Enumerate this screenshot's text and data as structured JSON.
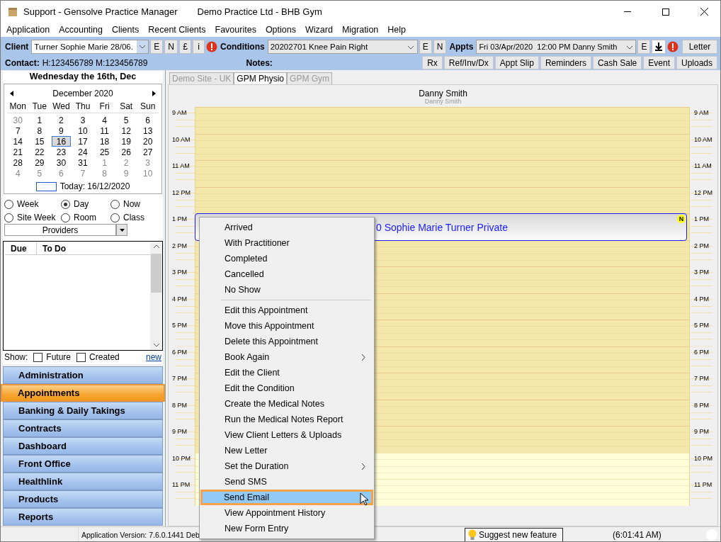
{
  "window": {
    "title": "Support - Gensolve Practice Manager",
    "subtitle": "Demo Practice Ltd - BHB Gym"
  },
  "menu_bar": [
    "Application",
    "Accounting",
    "Clients",
    "Recent Clients",
    "Favourites",
    "Options",
    "Wizard",
    "Migration",
    "Help"
  ],
  "client_bar": {
    "client_label": "Client",
    "client_value": "Turner Sophie Marie 28/06.",
    "client_buttons": [
      "E",
      "N",
      "£",
      "i"
    ],
    "conditions_label": "Conditions",
    "conditions_value": "20202701 Knee Pain Right",
    "condition_buttons": [
      "E",
      "N"
    ],
    "appts_label": "Appts",
    "appts_value": "Fri 03/Apr/2020  12:00 PM Danny Smith",
    "appt_buttons": [
      "E"
    ],
    "letter_button": "Letter",
    "contact_label": "Contact:",
    "contact_value": "H:123456789  M:123456789",
    "notes_label": "Notes:",
    "actions": [
      "Rx",
      "Ref/Inv/Dx",
      "Appt Slip",
      "Reminders",
      "Cash Sale",
      "Event",
      "Uploads"
    ]
  },
  "date_header": "Wednesday the 16th, Dec",
  "calendar": {
    "month": "December 2020",
    "weekdays": [
      "Mon",
      "Tue",
      "Wed",
      "Thu",
      "Fri",
      "Sat",
      "Sun"
    ],
    "weeks": [
      [
        {
          "day": "30",
          "muted": true,
          "selected": false
        },
        {
          "day": "1",
          "muted": false,
          "selected": false
        },
        {
          "day": "2",
          "muted": false,
          "selected": false
        },
        {
          "day": "3",
          "muted": false,
          "selected": false
        },
        {
          "day": "4",
          "muted": false,
          "selected": false
        },
        {
          "day": "5",
          "muted": false,
          "selected": false
        },
        {
          "day": "6",
          "muted": false,
          "selected": false
        }
      ],
      [
        {
          "day": "7",
          "muted": false,
          "selected": false
        },
        {
          "day": "8",
          "muted": false,
          "selected": false
        },
        {
          "day": "9",
          "muted": false,
          "selected": false
        },
        {
          "day": "10",
          "muted": false,
          "selected": false
        },
        {
          "day": "11",
          "muted": false,
          "selected": false
        },
        {
          "day": "12",
          "muted": false,
          "selected": false
        },
        {
          "day": "13",
          "muted": false,
          "selected": false
        }
      ],
      [
        {
          "day": "14",
          "muted": false,
          "selected": false
        },
        {
          "day": "15",
          "muted": false,
          "selected": false
        },
        {
          "day": "16",
          "muted": false,
          "selected": true
        },
        {
          "day": "17",
          "muted": false,
          "selected": false
        },
        {
          "day": "18",
          "muted": false,
          "selected": false
        },
        {
          "day": "19",
          "muted": false,
          "selected": false
        },
        {
          "day": "20",
          "muted": false,
          "selected": false
        }
      ],
      [
        {
          "day": "21",
          "muted": false,
          "selected": false
        },
        {
          "day": "22",
          "muted": false,
          "selected": false
        },
        {
          "day": "23",
          "muted": false,
          "selected": false
        },
        {
          "day": "24",
          "muted": false,
          "selected": false
        },
        {
          "day": "25",
          "muted": false,
          "selected": false
        },
        {
          "day": "26",
          "muted": false,
          "selected": false
        },
        {
          "day": "27",
          "muted": false,
          "selected": false
        }
      ],
      [
        {
          "day": "28",
          "muted": false,
          "selected": false
        },
        {
          "day": "29",
          "muted": false,
          "selected": false
        },
        {
          "day": "30",
          "muted": false,
          "selected": false
        },
        {
          "day": "31",
          "muted": false,
          "selected": false
        },
        {
          "day": "1",
          "muted": true,
          "selected": false
        },
        {
          "day": "2",
          "muted": true,
          "selected": false
        },
        {
          "day": "3",
          "muted": true,
          "selected": false
        }
      ],
      [
        {
          "day": "4",
          "muted": true,
          "selected": false
        },
        {
          "day": "5",
          "muted": true,
          "selected": false
        },
        {
          "day": "6",
          "muted": true,
          "selected": false
        },
        {
          "day": "7",
          "muted": true,
          "selected": false
        },
        {
          "day": "8",
          "muted": true,
          "selected": false
        },
        {
          "day": "9",
          "muted": true,
          "selected": false
        },
        {
          "day": "10",
          "muted": true,
          "selected": false
        }
      ]
    ],
    "today_label": "Today: 16/12/2020"
  },
  "view_options": [
    {
      "label": "Week",
      "selected": false
    },
    {
      "label": "Day",
      "selected": true
    },
    {
      "label": "Now",
      "selected": false
    },
    {
      "label": "Site Week",
      "selected": false
    },
    {
      "label": "Room",
      "selected": false
    },
    {
      "label": "Class",
      "selected": false
    }
  ],
  "providers": "Providers",
  "todo": {
    "columns": [
      "Due",
      "To Do"
    ]
  },
  "show": {
    "label": "Show:",
    "options": [
      {
        "label": "Future",
        "checked": false
      },
      {
        "label": "Created",
        "checked": false
      }
    ],
    "link": "new"
  },
  "nav": [
    {
      "label": "Administration",
      "selected": false
    },
    {
      "label": "Appointments",
      "selected": true
    },
    {
      "label": "Banking & Daily Takings",
      "selected": false
    },
    {
      "label": "Contracts",
      "selected": false
    },
    {
      "label": "Dashboard",
      "selected": false
    },
    {
      "label": "Front Office",
      "selected": false
    },
    {
      "label": "Healthlink",
      "selected": false
    },
    {
      "label": "Products",
      "selected": false
    },
    {
      "label": "Reports",
      "selected": false
    }
  ],
  "tabs": [
    {
      "label": "Demo Site - UK",
      "selected": false
    },
    {
      "label": "GPM Physio",
      "selected": true
    },
    {
      "label": "GPM Gym",
      "selected": false
    }
  ],
  "schedule": {
    "practitioner": "Danny Smith",
    "practitioner_sub": "Danny Smith",
    "hours": [
      {
        "label_left": "9 AM",
        "label_right": "9 AM",
        "closed": false
      },
      {
        "label_left": "10 AM",
        "label_right": "10 AM",
        "closed": false
      },
      {
        "label_left": "11 AM",
        "label_right": "11 AM",
        "closed": false
      },
      {
        "label_left": "12 PM",
        "label_right": "12 PM",
        "closed": false
      },
      {
        "label_left": "1 PM",
        "label_right": "1 PM",
        "closed": false
      },
      {
        "label_left": "2 PM",
        "label_right": "2 PM",
        "closed": false
      },
      {
        "label_left": "3 PM",
        "label_right": "3 PM",
        "closed": false
      },
      {
        "label_left": "4 PM",
        "label_right": "4 PM",
        "closed": false
      },
      {
        "label_left": "5 PM",
        "label_right": "5 PM",
        "closed": false
      },
      {
        "label_left": "6 PM",
        "label_right": "6 PM",
        "closed": false
      },
      {
        "label_left": "7 PM",
        "label_right": "7 PM",
        "closed": false
      },
      {
        "label_left": "8 PM",
        "label_right": "8 PM",
        "closed": false
      },
      {
        "label_left": "9 PM",
        "label_right": "9 PM",
        "closed": false
      },
      {
        "label_left": "10 PM",
        "label_right": "10 PM",
        "closed": true
      },
      {
        "label_left": "11 PM",
        "label_right": "11 PM",
        "closed": true
      }
    ],
    "appointment": {
      "text": "0 Sophie Marie Turner Private",
      "badge": "N"
    }
  },
  "context_menu": [
    {
      "kind": "item",
      "label": "Arrived",
      "submenu": false,
      "selected": false
    },
    {
      "kind": "item",
      "label": "With Practitioner",
      "submenu": false,
      "selected": false
    },
    {
      "kind": "item",
      "label": "Completed",
      "submenu": false,
      "selected": false
    },
    {
      "kind": "item",
      "label": "Cancelled",
      "submenu": false,
      "selected": false
    },
    {
      "kind": "item",
      "label": "No Show",
      "submenu": false,
      "selected": false
    },
    {
      "kind": "separator"
    },
    {
      "kind": "item",
      "label": "Edit this Appointment",
      "submenu": false,
      "selected": false
    },
    {
      "kind": "item",
      "label": "Move this Appointment",
      "submenu": false,
      "selected": false
    },
    {
      "kind": "item",
      "label": "Delete this Appointment",
      "submenu": false,
      "selected": false
    },
    {
      "kind": "item",
      "label": "Book Again",
      "submenu": true,
      "selected": false
    },
    {
      "kind": "item",
      "label": "Edit the Client",
      "submenu": false,
      "selected": false
    },
    {
      "kind": "item",
      "label": "Edit the Condition",
      "submenu": false,
      "selected": false
    },
    {
      "kind": "item",
      "label": "Create the Medical Notes",
      "submenu": false,
      "selected": false
    },
    {
      "kind": "item",
      "label": "Run the Medical Notes Report",
      "submenu": false,
      "selected": false
    },
    {
      "kind": "item",
      "label": "View Client Letters & Uploads",
      "submenu": false,
      "selected": false
    },
    {
      "kind": "item",
      "label": "New Letter",
      "submenu": false,
      "selected": false
    },
    {
      "kind": "item",
      "label": "Set the Duration",
      "submenu": true,
      "selected": false
    },
    {
      "kind": "item",
      "label": "Send SMS",
      "submenu": false,
      "selected": false
    },
    {
      "kind": "item",
      "label": "Send Email",
      "submenu": false,
      "selected": true
    },
    {
      "kind": "item",
      "label": "View Appointment History",
      "submenu": false,
      "selected": false
    },
    {
      "kind": "item",
      "label": "New Form Entry",
      "submenu": false,
      "selected": false
    }
  ],
  "status_bar": {
    "version": "Application Version: 7.6.0.1441 Deb",
    "suggest_button": "Suggest new feature",
    "time": "(6:01:41 AM)"
  }
}
